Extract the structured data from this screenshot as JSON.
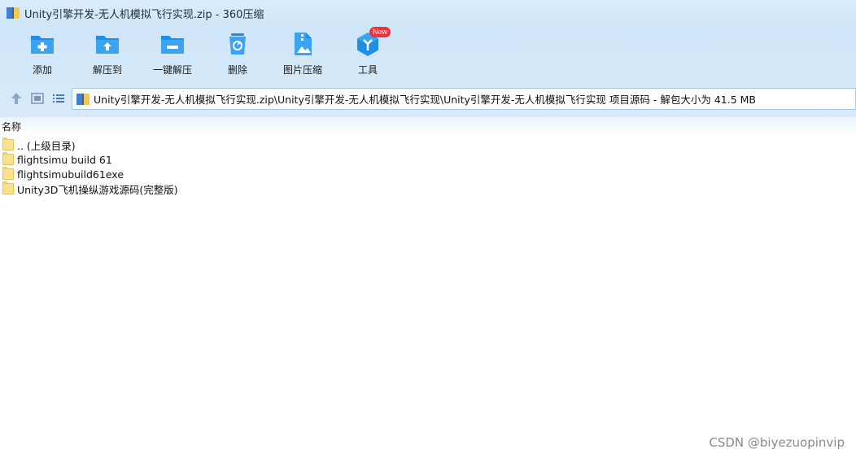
{
  "window": {
    "title": "Unity引擎开发-无人机模拟飞行实现.zip - 360压缩"
  },
  "toolbar": {
    "items": [
      {
        "label": "添加",
        "icon": "add-folder-icon"
      },
      {
        "label": "解压到",
        "icon": "extract-to-icon"
      },
      {
        "label": "一键解压",
        "icon": "one-click-extract-icon"
      },
      {
        "label": "删除",
        "icon": "delete-bin-icon"
      },
      {
        "label": "图片压缩",
        "icon": "image-compress-icon"
      },
      {
        "label": "工具",
        "icon": "tools-icon",
        "badge": "New"
      }
    ]
  },
  "nav": {
    "path": "Unity引擎开发-无人机模拟飞行实现.zip\\Unity引擎开发-无人机模拟飞行实现\\Unity引擎开发-无人机模拟飞行实现 项目源码 - 解包大小为 41.5 MB"
  },
  "list": {
    "header": "名称",
    "items": [
      {
        "name": ".. (上级目录)"
      },
      {
        "name": "flightsimu build 61"
      },
      {
        "name": "flightsimubuild61exe"
      },
      {
        "name": "Unity3D飞机操纵游戏源码(完整版)"
      }
    ]
  },
  "watermark": "CSDN @biyezuopinvip",
  "colors": {
    "accent": "#1e8fe6",
    "badge": "#e8343a",
    "folder": "#fce18c"
  }
}
